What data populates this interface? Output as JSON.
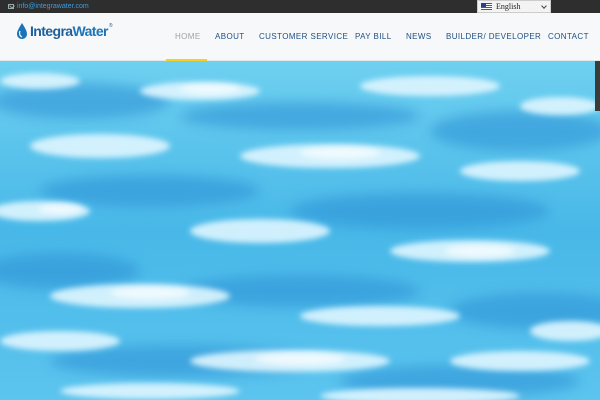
{
  "topbar": {
    "email": "info@integrawater.com",
    "email_icon": "envelope-icon"
  },
  "language": {
    "selected": "English",
    "flag_icon": "us-flag-icon"
  },
  "brand": {
    "name_part1": "Integra",
    "name_part2": "Water",
    "registered": "®",
    "logo_icon": "water-drop-icon",
    "color": "#1f5f9b"
  },
  "nav": {
    "items": [
      {
        "label": "HOME",
        "active": true
      },
      {
        "label": "ABOUT"
      },
      {
        "label": "CUSTOMER SERVICE"
      },
      {
        "label": "PAY BILL"
      },
      {
        "label": "NEWS"
      },
      {
        "label": "BUILDER/ DEVELOPER"
      },
      {
        "label": "CONTACT"
      }
    ],
    "active_color": "#f4d21f",
    "text_color": "#1d4f86"
  },
  "hero": {
    "image": "water-surface"
  }
}
